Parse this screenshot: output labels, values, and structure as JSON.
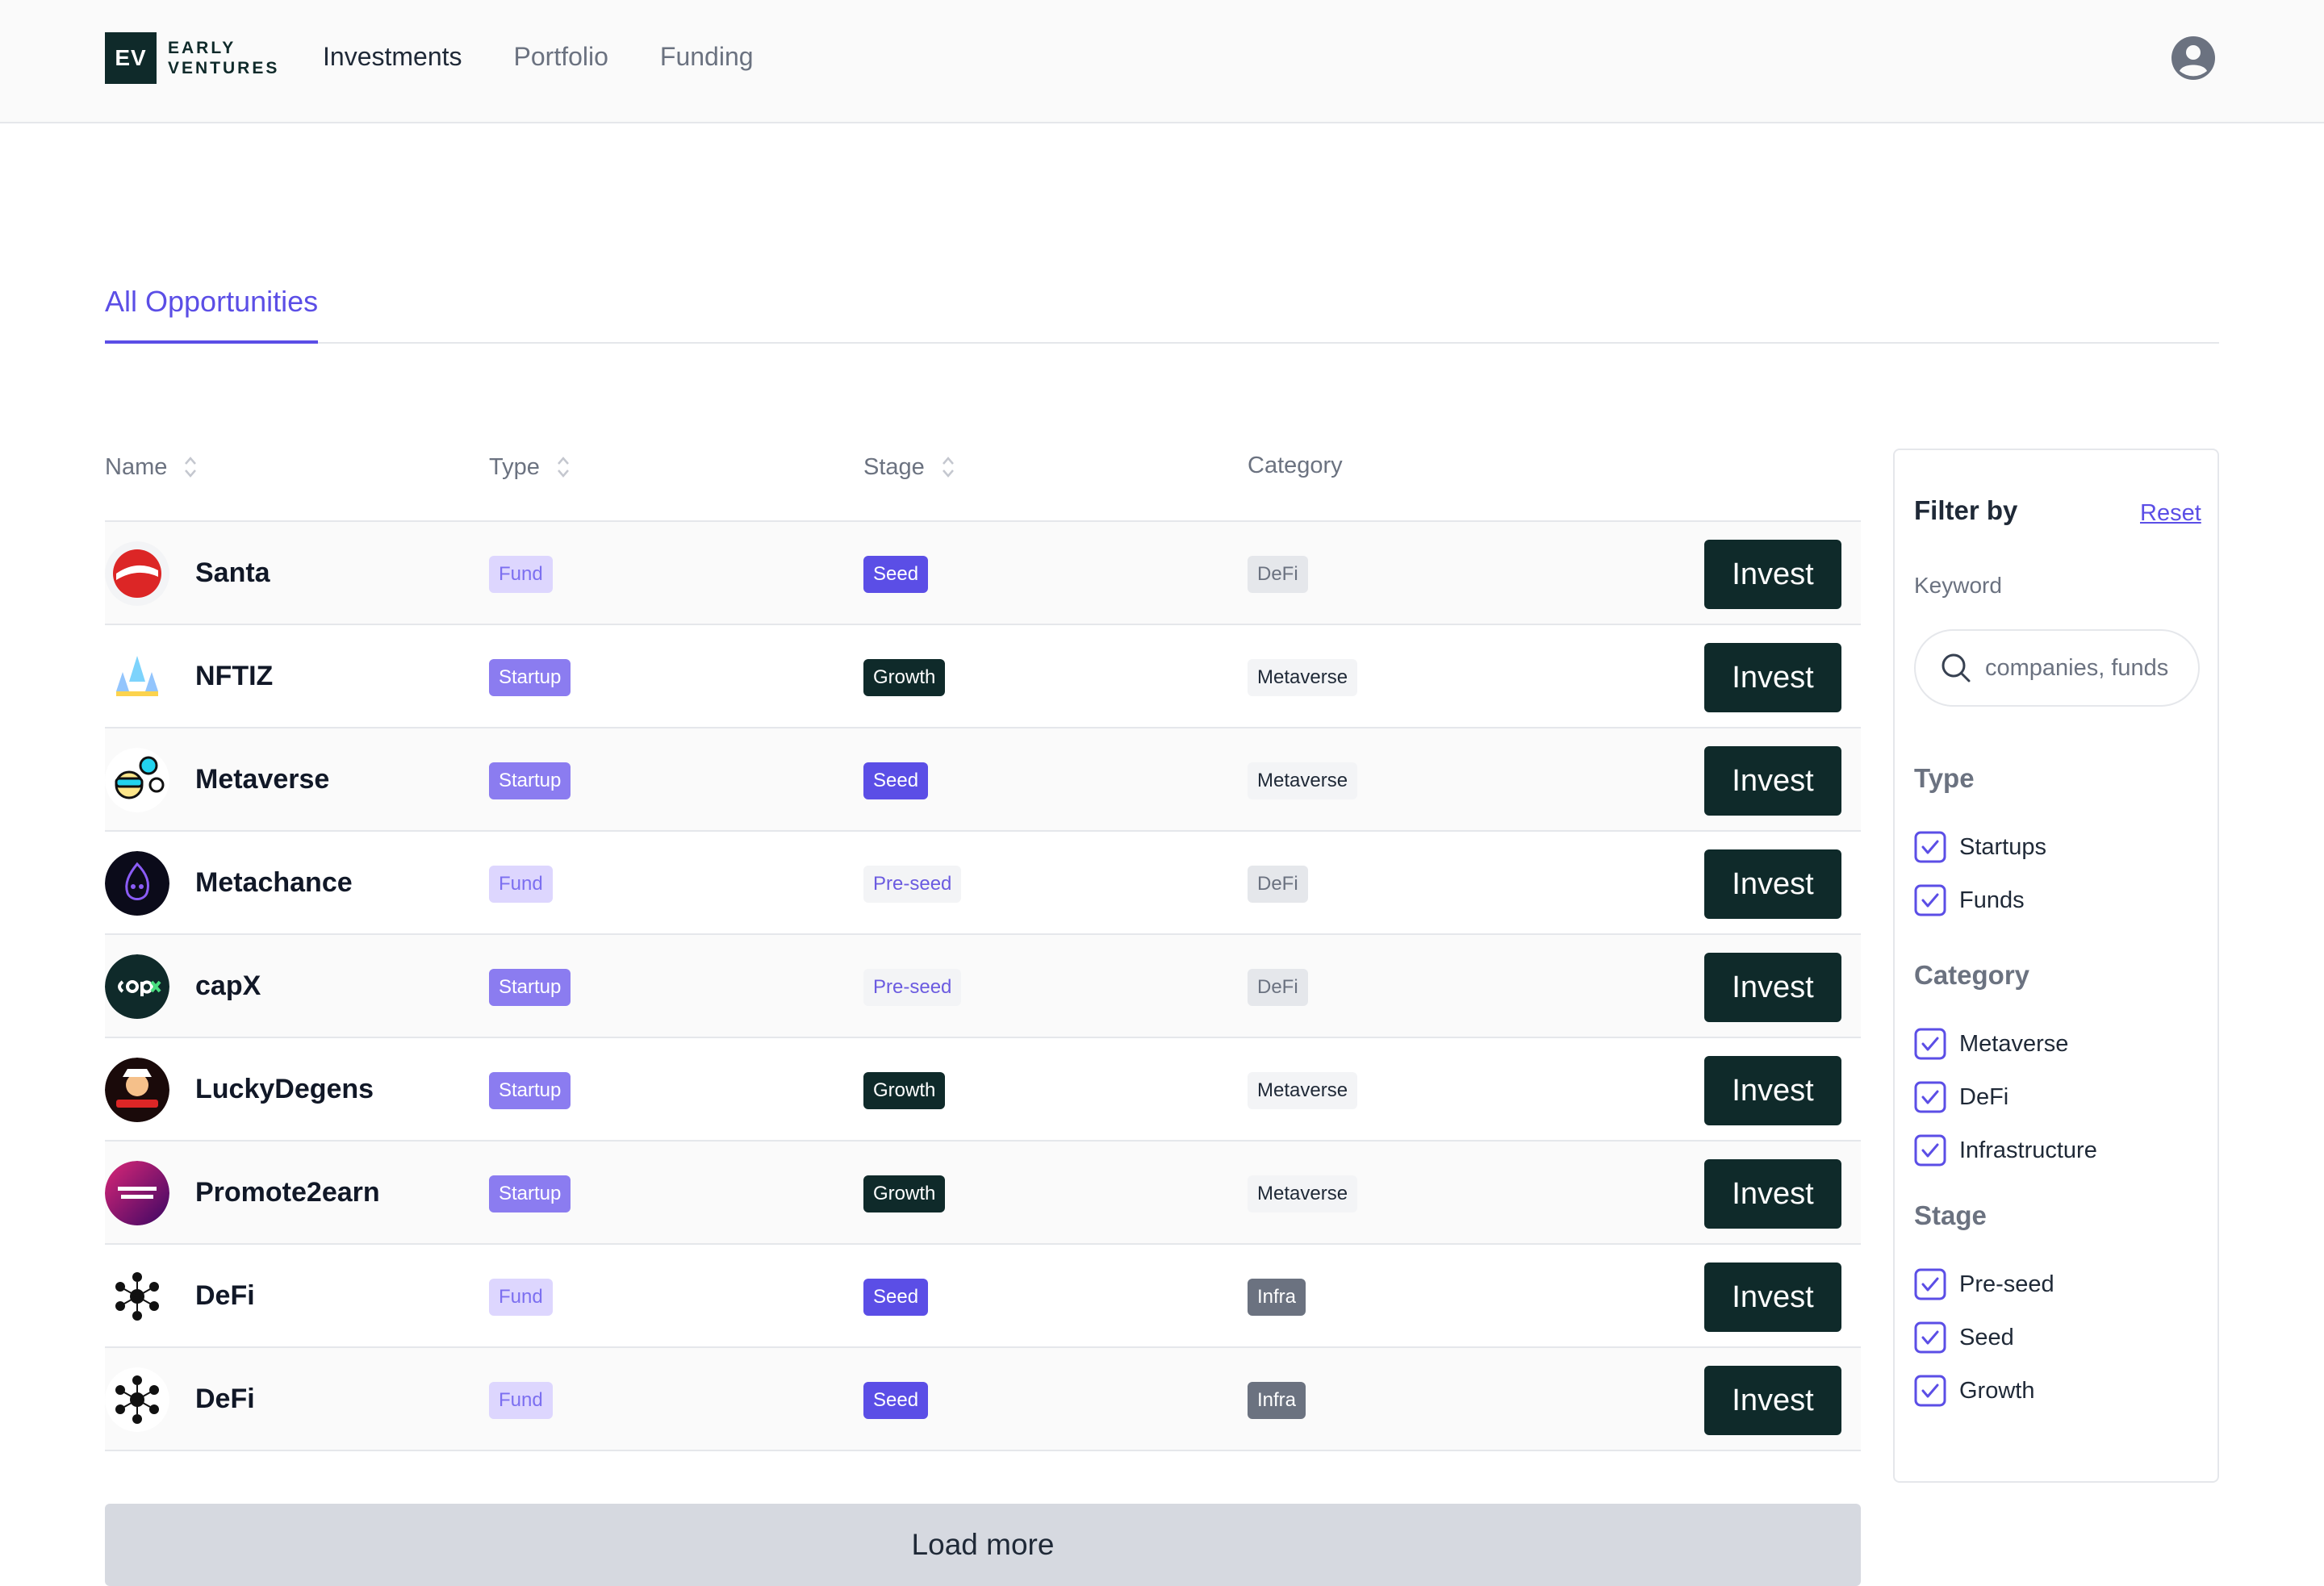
{
  "header": {
    "logo_mark": "EV",
    "logo_line1": "EARLY",
    "logo_line2": "VENTURES",
    "nav": [
      {
        "label": "Investments",
        "active": true
      },
      {
        "label": "Portfolio",
        "active": false
      },
      {
        "label": "Funding",
        "active": false
      }
    ],
    "avatar_icon": "user-circle-icon"
  },
  "tabs": {
    "active_label": "All Opportunities"
  },
  "table": {
    "columns": {
      "name": "Name",
      "type": "Type",
      "stage": "Stage",
      "category": "Category"
    },
    "invest_label": "Invest",
    "rows": [
      {
        "name": "Santa",
        "type": "Fund",
        "stage": "Seed",
        "category": "DeFi",
        "logo": "santa-logo-icon"
      },
      {
        "name": "NFTIZ",
        "type": "Startup",
        "stage": "Growth",
        "category": "Metaverse",
        "logo": "nftiz-logo-icon"
      },
      {
        "name": "Metaverse",
        "type": "Startup",
        "stage": "Seed",
        "category": "Metaverse",
        "logo": "metaverse-logo-icon"
      },
      {
        "name": "Metachance",
        "type": "Fund",
        "stage": "Pre-seed",
        "category": "DeFi",
        "logo": "metachance-logo-icon"
      },
      {
        "name": "capX",
        "type": "Startup",
        "stage": "Pre-seed",
        "category": "DeFi",
        "logo": "capx-logo-icon"
      },
      {
        "name": "LuckyDegens",
        "type": "Startup",
        "stage": "Growth",
        "category": "Metaverse",
        "logo": "luckydegens-logo-icon"
      },
      {
        "name": "Promote2earn",
        "type": "Startup",
        "stage": "Growth",
        "category": "Metaverse",
        "logo": "promote2earn-logo-icon"
      },
      {
        "name": "DeFi",
        "type": "Fund",
        "stage": "Seed",
        "category": "Infra",
        "logo": "defi-logo-icon"
      },
      {
        "name": "DeFi",
        "type": "Fund",
        "stage": "Seed",
        "category": "Infra",
        "logo": "defi-logo-icon"
      }
    ],
    "load_more": "Load more"
  },
  "filter": {
    "title": "Filter by",
    "reset": "Reset",
    "keyword_label": "Keyword",
    "search_placeholder": "companies, funds",
    "sections": {
      "type": {
        "title": "Type",
        "options": [
          {
            "label": "Startups",
            "checked": true
          },
          {
            "label": "Funds",
            "checked": true
          }
        ]
      },
      "category": {
        "title": "Category",
        "options": [
          {
            "label": "Metaverse",
            "checked": true
          },
          {
            "label": "DeFi",
            "checked": true
          },
          {
            "label": "Infrastructure",
            "checked": true
          }
        ]
      },
      "stage": {
        "title": "Stage",
        "options": [
          {
            "label": "Pre-seed",
            "checked": true
          },
          {
            "label": "Seed",
            "checked": true
          },
          {
            "label": "Growth",
            "checked": true
          }
        ]
      }
    }
  },
  "colors": {
    "accent": "#5b4ee6",
    "dark": "#0f2a2a",
    "startup_badge": "#8b7cf0",
    "fund_badge": "#ddd6fe"
  }
}
